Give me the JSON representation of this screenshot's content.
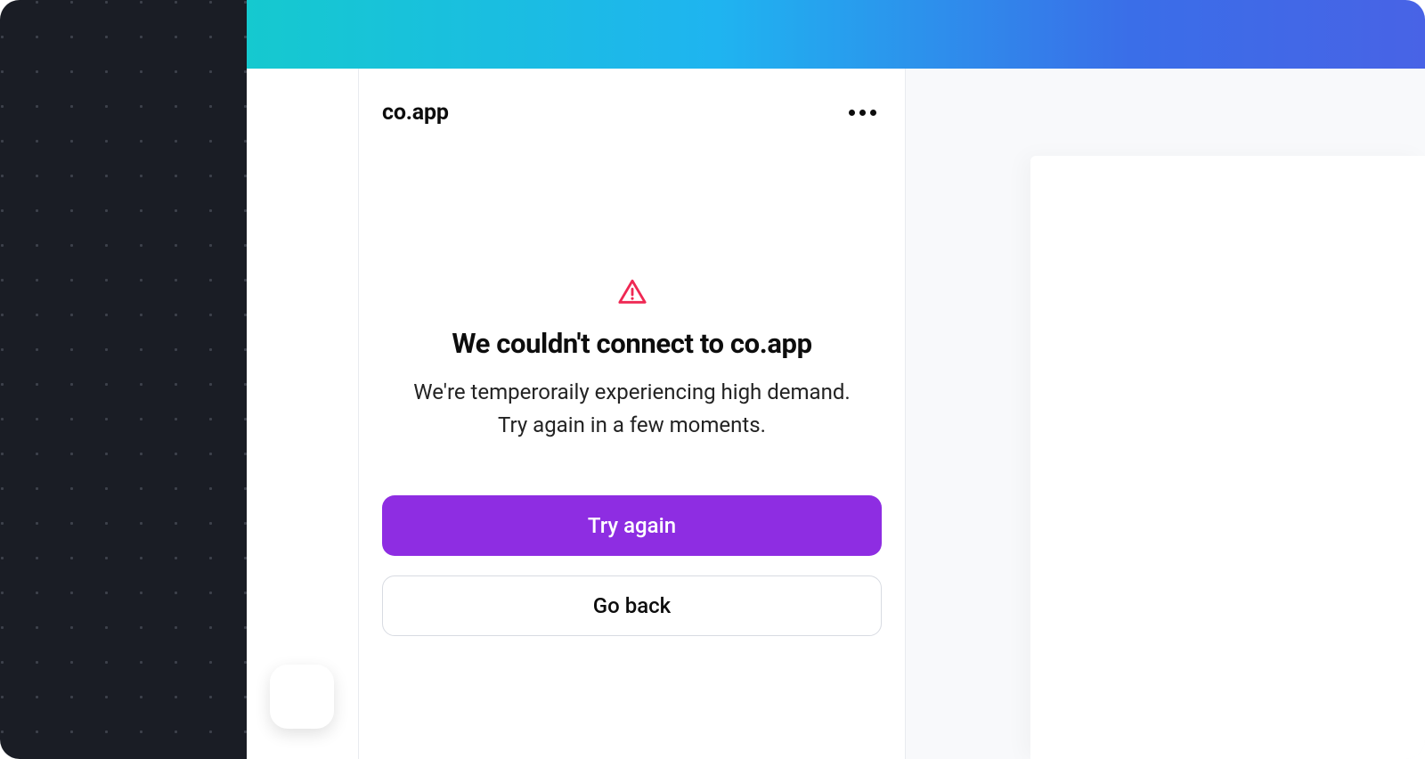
{
  "header": {
    "app_title": "co.app"
  },
  "error": {
    "heading": "We couldn't connect to co.app",
    "body_line1": "We're temperoraily experiencing high demand.",
    "body_line2": "Try again in a few moments."
  },
  "buttons": {
    "primary": "Try again",
    "secondary": "Go back"
  },
  "colors": {
    "accent": "#8e2de2",
    "danger": "#ef2853"
  }
}
